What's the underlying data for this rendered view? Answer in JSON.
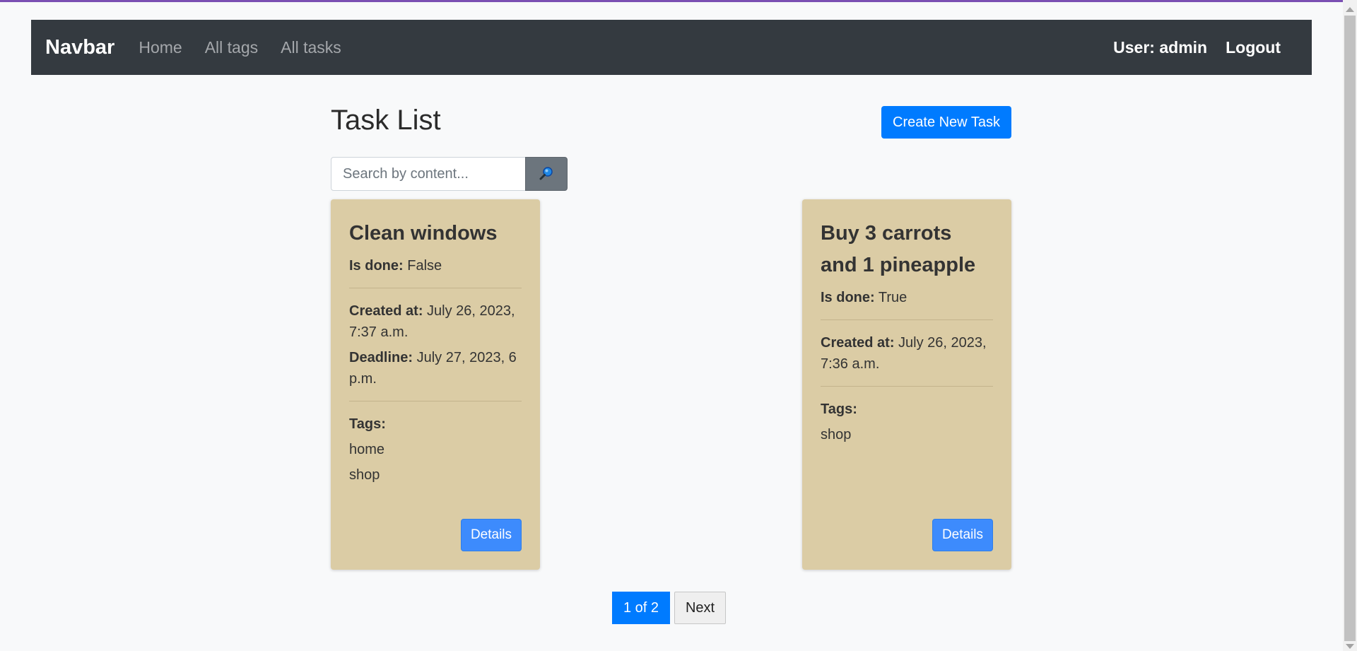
{
  "navbar": {
    "brand": "Navbar",
    "links": [
      "Home",
      "All tags",
      "All tasks"
    ],
    "user": "User: admin",
    "logout": "Logout"
  },
  "header": {
    "title": "Task List",
    "create_button": "Create New Task"
  },
  "search": {
    "placeholder": "Search by content...",
    "icon": "search-icon"
  },
  "tasks": [
    {
      "title": "Clean windows",
      "is_done_label": "Is done:",
      "is_done": "False",
      "created_label": "Created at:",
      "created_at": "July 26, 2023, 7:37 a.m.",
      "deadline_label": "Deadline:",
      "deadline": "July 27, 2023, 6 p.m.",
      "tags_label": "Tags:",
      "tags": [
        "home",
        "shop"
      ],
      "details": "Details"
    },
    {
      "title": "Buy 3 carrots and 1 pineapple",
      "is_done_label": "Is done:",
      "is_done": "True",
      "created_label": "Created at:",
      "created_at": "July 26, 2023, 7:36 a.m.",
      "tags_label": "Tags:",
      "tags": [
        "shop"
      ],
      "details": "Details"
    }
  ],
  "pagination": {
    "current": "1 of 2",
    "next": "Next"
  },
  "colors": {
    "navbar_bg": "#343a40",
    "primary": "#007bff",
    "card_bg": "#dbcca5",
    "page_bg": "#f8f9fa"
  }
}
